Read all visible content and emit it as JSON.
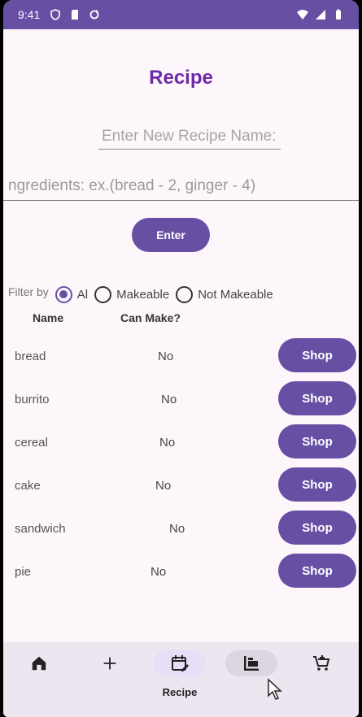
{
  "status_bar": {
    "time": "9:41",
    "left_icons": [
      "shield-icon",
      "sd-card-icon",
      "sync-icon"
    ],
    "right_icons": [
      "wifi-icon",
      "signal-icon",
      "battery-icon"
    ]
  },
  "page": {
    "title": "Recipe",
    "name_input": {
      "placeholder": "Enter New Recipe Name:",
      "value": ""
    },
    "ingredients_input": {
      "placeholder": "ngredients: ex.(bread - 2, ginger - 4)",
      "value": ""
    },
    "enter_label": "Enter"
  },
  "filter": {
    "label": "Filter by",
    "options": [
      {
        "label": "Al",
        "checked": true
      },
      {
        "label": "Makeable",
        "checked": false
      },
      {
        "label": "Not Makeable",
        "checked": false
      }
    ]
  },
  "table": {
    "headers": {
      "name": "Name",
      "can_make": "Can Make?"
    },
    "rows": [
      {
        "name": "bread",
        "can_make": "No",
        "action": "Shop"
      },
      {
        "name": "burrito",
        "can_make": "No",
        "action": "Shop"
      },
      {
        "name": "cereal",
        "can_make": "No",
        "action": "Shop"
      },
      {
        "name": "cake",
        "can_make": "No",
        "action": "Shop"
      },
      {
        "name": "sandwich",
        "can_make": "No",
        "action": "Shop"
      },
      {
        "name": "pie",
        "can_make": "No",
        "action": "Shop"
      }
    ]
  },
  "bottom_nav": {
    "items": [
      {
        "icon": "home-icon",
        "label": ""
      },
      {
        "icon": "add-icon",
        "label": ""
      },
      {
        "icon": "calendar-edit-icon",
        "label": "Recipe",
        "active": true
      },
      {
        "icon": "inventory-icon",
        "label": ""
      },
      {
        "icon": "add-cart-icon",
        "label": ""
      }
    ]
  },
  "colors": {
    "primary": "#6750a4",
    "title": "#6d2aa8",
    "background": "#fdf7fc",
    "nav_background": "#ece6f0"
  }
}
